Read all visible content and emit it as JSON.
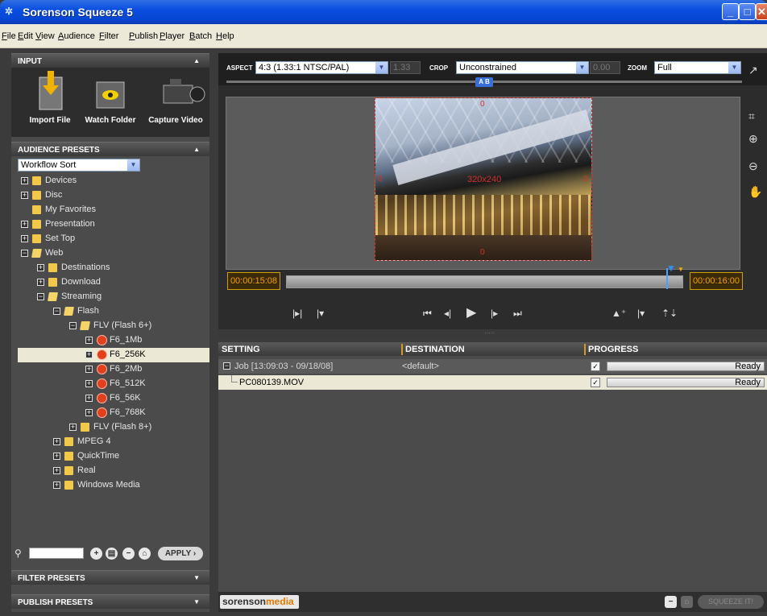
{
  "window": {
    "title": "Sorenson Squeeze 5"
  },
  "menu": [
    "File",
    "Edit",
    "View",
    "Audience",
    "Filter",
    "Publish",
    "Player",
    "Batch",
    "Help"
  ],
  "input_panel": {
    "title": "INPUT",
    "buttons": [
      "Import File",
      "Watch Folder",
      "Capture Video"
    ]
  },
  "audience_presets": {
    "title": "AUDIENCE PRESETS",
    "sort_value": "Workflow Sort",
    "tree": [
      {
        "label": "Devices",
        "depth": 0,
        "expander": "+",
        "icon": "folder"
      },
      {
        "label": "Disc",
        "depth": 0,
        "expander": "+",
        "icon": "folder"
      },
      {
        "label": "My Favorites",
        "depth": 0,
        "expander": "",
        "icon": "folder"
      },
      {
        "label": "Presentation",
        "depth": 0,
        "expander": "+",
        "icon": "folder"
      },
      {
        "label": "Set Top",
        "depth": 0,
        "expander": "+",
        "icon": "folder"
      },
      {
        "label": "Web",
        "depth": 0,
        "expander": "-",
        "icon": "folder-open"
      },
      {
        "label": "Destinations",
        "depth": 1,
        "expander": "+",
        "icon": "folder"
      },
      {
        "label": "Download",
        "depth": 1,
        "expander": "+",
        "icon": "folder"
      },
      {
        "label": "Streaming",
        "depth": 1,
        "expander": "-",
        "icon": "folder-open"
      },
      {
        "label": "Flash",
        "depth": 2,
        "expander": "-",
        "icon": "folder-open"
      },
      {
        "label": "FLV (Flash 6+)",
        "depth": 3,
        "expander": "-",
        "icon": "folder-open"
      },
      {
        "label": "F6_1Mb",
        "depth": 4,
        "expander": "+",
        "icon": "preset"
      },
      {
        "label": "F6_256K",
        "depth": 4,
        "expander": "+",
        "icon": "preset",
        "selected": true
      },
      {
        "label": "F6_2Mb",
        "depth": 4,
        "expander": "+",
        "icon": "preset"
      },
      {
        "label": "F6_512K",
        "depth": 4,
        "expander": "+",
        "icon": "preset"
      },
      {
        "label": "F6_56K",
        "depth": 4,
        "expander": "+",
        "icon": "preset"
      },
      {
        "label": "F6_768K",
        "depth": 4,
        "expander": "+",
        "icon": "preset"
      },
      {
        "label": "FLV (Flash 8+)",
        "depth": 3,
        "expander": "+",
        "icon": "folder"
      },
      {
        "label": "MPEG 4",
        "depth": 2,
        "expander": "+",
        "icon": "folder"
      },
      {
        "label": "QuickTime",
        "depth": 2,
        "expander": "+",
        "icon": "folder"
      },
      {
        "label": "Real",
        "depth": 2,
        "expander": "+",
        "icon": "folder"
      },
      {
        "label": "Windows Media",
        "depth": 2,
        "expander": "+",
        "icon": "folder"
      }
    ],
    "apply_label": "APPLY",
    "search_value": ""
  },
  "filter_presets": {
    "title": "FILTER PRESETS"
  },
  "publish_presets": {
    "title": "PUBLISH PRESETS"
  },
  "preview": {
    "aspect_label": "ASPECT",
    "aspect_value": "4:3 (1.33:1 NTSC/PAL)",
    "aspect_ratio": "1.33",
    "crop_label": "CROP",
    "crop_value": "Unconstrained",
    "crop_ratio": "0.00",
    "zoom_label": "ZOOM",
    "zoom_value": "Full",
    "ab_label": "A B",
    "frame_size": "320x240",
    "crop_top": "0",
    "crop_left": "0",
    "crop_right": "0",
    "crop_bottom": "0",
    "time_in": "00:00:15:08",
    "time_out": "00:00:16:00",
    "scrub_position": 0.96
  },
  "job_list": {
    "columns": [
      "SETTING",
      "DESTINATION",
      "PROGRESS"
    ],
    "rows": [
      {
        "setting": "Job [13:09:03 - 09/18/08]",
        "destination": "<default>",
        "status": "Ready"
      },
      {
        "setting": "PC080139.MOV",
        "destination": "",
        "status": "Ready"
      }
    ]
  },
  "footer": {
    "logo_a": "sorenson",
    "logo_b": "media",
    "squeeze_label": "SQUEEZE IT!"
  }
}
